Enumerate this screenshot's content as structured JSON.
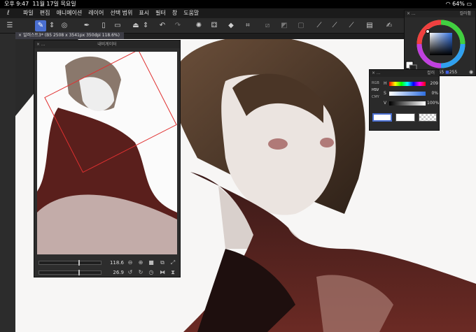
{
  "status": {
    "time": "오후 9:47",
    "date": "11월 17일 목요일",
    "battery": "64%"
  },
  "menu": [
    "파일",
    "편집",
    "애니메이션",
    "레이어",
    "선택 범위",
    "표시",
    "필터",
    "창",
    "도움말"
  ],
  "document_tab": "일러스트3* (B5 2508 x 3541px 350dpi 118.6%)",
  "navigator": {
    "title": "내비게이터",
    "zoom": "118.6",
    "angle": "26.9"
  },
  "color_wheel": {
    "title": "컬러휠",
    "rgb_readout": {
      "r": "255",
      "g": "255",
      "b": "255"
    }
  },
  "color_slider": {
    "title": "컬러",
    "modes": [
      "RGB",
      "HSV",
      "CMY"
    ],
    "h": {
      "label": "H",
      "value": "209"
    },
    "s": {
      "label": "S",
      "value": "0%"
    },
    "v": {
      "label": "V",
      "value": "100%"
    }
  },
  "colors": {
    "accent": "#4a6fd1",
    "panel": "#2d2d2d",
    "toolbar": "#2a2a2a"
  }
}
